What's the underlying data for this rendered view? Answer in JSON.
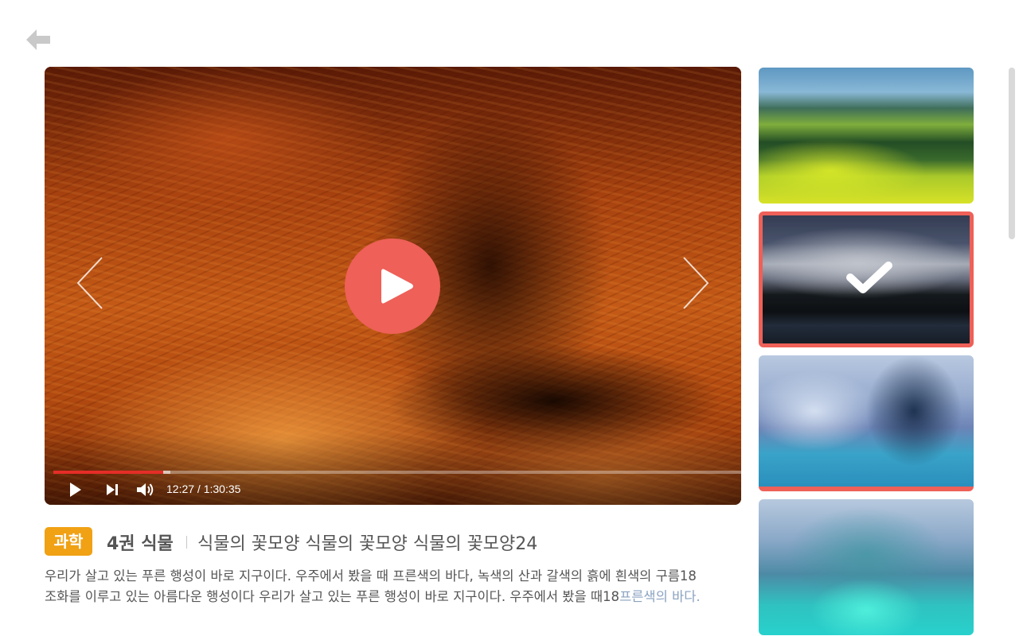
{
  "navigation": {
    "back_icon": "arrow-left-icon"
  },
  "player": {
    "time_text": "12:27 / 1:30:35",
    "progress_percent": 16,
    "buffered_percent": 1,
    "prev_icon": "chevron-left-icon",
    "next_icon": "chevron-right-icon",
    "play_icon": "play-icon",
    "accent_color": "#ee6058",
    "progress_color": "#e52d27"
  },
  "content": {
    "category": "과학",
    "category_color": "#f0a114",
    "book": "4권 식물",
    "title": "식물의 꽃모양 식물의 꽃모양 식물의 꽃모양24",
    "description_line1": "우리가 살고 있는 푸른 행성이 바로 지구이다. 우주에서 봤을 때 프른색의 바다, 녹색의 산과 갈색의 흙에 흰색의 구름18",
    "description_line2": "조화를 이루고 있는 아름다운 행성이다 우리가 살고 있는 푸른 행성이 바로 지구이다. 우주에서 봤을 때18",
    "description_line2_faded": "프른색의 바다."
  },
  "playlist": {
    "selected_index": 1,
    "items": [
      {
        "scene": "green hills landscape"
      },
      {
        "scene": "snowy mountain lake",
        "selected_icon": "check-icon"
      },
      {
        "scene": "marble caves"
      },
      {
        "scene": "turquoise marble cave"
      }
    ]
  }
}
